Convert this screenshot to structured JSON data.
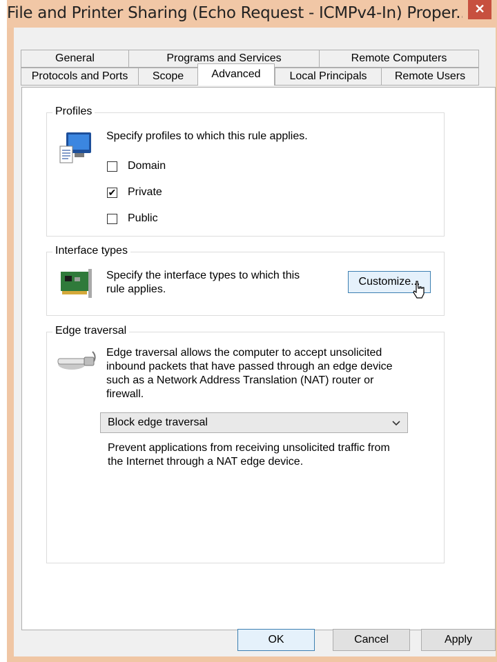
{
  "window": {
    "title": "File and Printer Sharing (Echo Request - ICMPv4-In) Proper...",
    "close_glyph": "✕"
  },
  "tabs": {
    "row1": [
      "General",
      "Programs and Services",
      "Remote Computers"
    ],
    "row2": [
      "Protocols and Ports",
      "Scope",
      "Advanced",
      "Local Principals",
      "Remote Users"
    ],
    "active": "Advanced"
  },
  "profiles": {
    "legend": "Profiles",
    "description": "Specify profiles to which this rule applies.",
    "icon": "monitor-document-icon",
    "options": [
      {
        "label": "Domain",
        "checked": false
      },
      {
        "label": "Private",
        "checked": true
      },
      {
        "label": "Public",
        "checked": false
      }
    ]
  },
  "interface_types": {
    "legend": "Interface types",
    "description_line1": "Specify the interface types to which this",
    "description_line2": "rule applies.",
    "icon": "network-card-icon",
    "customize_label": "Customize..."
  },
  "edge_traversal": {
    "legend": "Edge traversal",
    "icon": "network-cable-icon",
    "description_lines": [
      "Edge traversal allows the computer to accept unsolicited",
      "inbound packets that have passed through an edge device",
      "such as a Network Address Translation (NAT) router or",
      "firewall."
    ],
    "selected_option": "Block edge traversal",
    "option_description_lines": [
      "Prevent applications from receiving unsolicited traffic from",
      "the Internet through a NAT edge device."
    ]
  },
  "buttons": {
    "ok": "OK",
    "cancel": "Cancel",
    "apply": "Apply"
  },
  "colors": {
    "title_bar": "#f1c7a6",
    "close_button": "#c7503f",
    "default_button_border": "#3c7fb1"
  }
}
